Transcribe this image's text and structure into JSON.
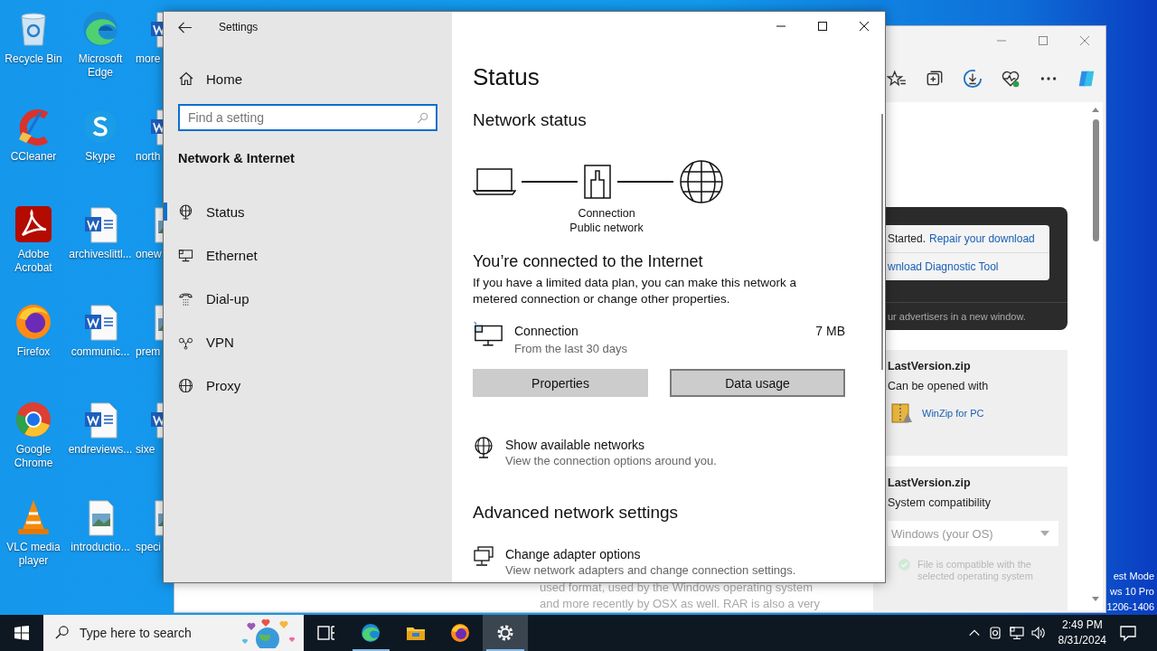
{
  "desktop": {
    "icons": [
      {
        "label": "Recycle Bin",
        "kind": "recycle"
      },
      {
        "label": "Microsoft Edge",
        "kind": "edge"
      },
      {
        "label": "more",
        "kind": "word"
      },
      {
        "label": "CCleaner",
        "kind": "ccleaner"
      },
      {
        "label": "Skype",
        "kind": "skype"
      },
      {
        "label": "north",
        "kind": "word"
      },
      {
        "label": "Adobe Acrobat",
        "kind": "acrobat"
      },
      {
        "label": "archiveslittl...",
        "kind": "word"
      },
      {
        "label": "onew",
        "kind": "image"
      },
      {
        "label": "Firefox",
        "kind": "firefox"
      },
      {
        "label": "communic...",
        "kind": "word"
      },
      {
        "label": "prem",
        "kind": "image"
      },
      {
        "label": "Google Chrome",
        "kind": "chrome"
      },
      {
        "label": "endreviews...",
        "kind": "word"
      },
      {
        "label": "sixe",
        "kind": "word"
      },
      {
        "label": "VLC media player",
        "kind": "vlc"
      },
      {
        "label": "introductio...",
        "kind": "image"
      },
      {
        "label": "speci",
        "kind": "image"
      }
    ],
    "watermark": [
      "est Mode",
      "ws 10 Pro",
      "1206-1406"
    ]
  },
  "browser": {
    "alert": {
      "lines": [
        {
          "prefix": "Started.",
          "link": "Repair your download"
        },
        {
          "link": "wnload Diagnostic Tool"
        }
      ],
      "footer": "ur advertisers in a new window."
    },
    "cards": [
      {
        "kind": "app",
        "title": "LastVersion.zip",
        "subtitle": "Can be opened with",
        "app": "WinZip for PC"
      },
      {
        "kind": "select",
        "title": "LastVersion.zip",
        "subtitle": "System compatibility",
        "value": "Windows (your OS)",
        "note": [
          "File is compatible with the",
          "selected operating system"
        ]
      }
    ],
    "page_text": [
      "used format, used by the Windows operating system",
      "and more recently by OSX as well. RAR is also a very"
    ]
  },
  "settings": {
    "title": "Settings",
    "home": "Home",
    "search_placeholder": "Find a setting",
    "section": "Network & Internet",
    "nav": [
      {
        "label": "Status",
        "kind": "status",
        "selected": true
      },
      {
        "label": "Ethernet",
        "kind": "ethernet",
        "selected": false
      },
      {
        "label": "Dial-up",
        "kind": "dialup",
        "selected": false
      },
      {
        "label": "VPN",
        "kind": "vpn",
        "selected": false
      },
      {
        "label": "Proxy",
        "kind": "proxy",
        "selected": false
      }
    ],
    "page": {
      "title": "Status",
      "subtitle": "Network status",
      "diagram_labels": [
        "Connection",
        "Public network"
      ],
      "connected": "You’re connected to the Internet",
      "description": "If you have a limited data plan, you can make this network a metered connection or change other properties.",
      "connection": {
        "name": "Connection",
        "period": "From the last 30 days",
        "usage": "7 MB"
      },
      "buttons": [
        {
          "label": "Properties",
          "focused": false
        },
        {
          "label": "Data usage",
          "focused": true
        }
      ],
      "links": [
        {
          "kind": "networks",
          "title": "Show available networks",
          "description": "View the connection options around you."
        }
      ],
      "advanced_title": "Advanced network settings",
      "advanced": [
        {
          "kind": "adapter",
          "title": "Change adapter options",
          "description": "View network adapters and change connection settings."
        }
      ]
    }
  },
  "taskbar": {
    "search_placeholder": "Type here to search",
    "apps": [
      {
        "kind": "taskview",
        "running": false,
        "active": false
      },
      {
        "kind": "edge",
        "running": true,
        "active": false
      },
      {
        "kind": "explorer",
        "running": false,
        "active": false
      },
      {
        "kind": "firefox",
        "running": false,
        "active": false
      },
      {
        "kind": "settings",
        "running": true,
        "active": true
      }
    ],
    "time": "2:49 PM",
    "date": "8/31/2024"
  }
}
